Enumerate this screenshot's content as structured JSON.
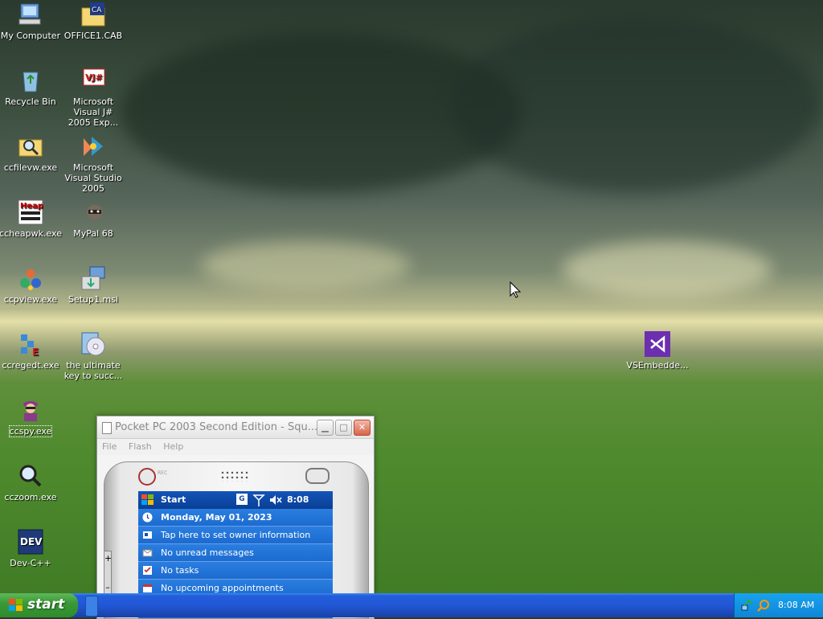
{
  "desktop": {
    "icons": [
      {
        "label": "My Computer",
        "icon": "computer-icon"
      },
      {
        "label": "OFFICE1.CAB",
        "icon": "cab-file-icon"
      },
      {
        "label": "Recycle Bin",
        "icon": "recycle-bin-icon"
      },
      {
        "label": "Microsoft Visual J# 2005 Exp...",
        "icon": "vjsharp-icon"
      },
      {
        "label": "ccfilevw.exe",
        "icon": "magnifier-folder-icon"
      },
      {
        "label": "Microsoft Visual Studio 2005",
        "icon": "visual-studio-icon"
      },
      {
        "label": "ccheapwk.exe",
        "icon": "heap-icon"
      },
      {
        "label": "MyPal 68",
        "icon": "raccoon-icon"
      },
      {
        "label": "ccpview.exe",
        "icon": "process-viewer-icon"
      },
      {
        "label": "Setup1.msi",
        "icon": "installer-icon"
      },
      {
        "label": "ccregedt.exe",
        "icon": "registry-editor-icon"
      },
      {
        "label": "the ultimate key to succ...",
        "icon": "cd-icon"
      },
      {
        "label": "ccspy.exe",
        "icon": "spy-icon"
      },
      {
        "label": "cczoom.exe",
        "icon": "zoom-icon"
      },
      {
        "label": "Dev-C++",
        "icon": "devcpp-icon"
      },
      {
        "label": "VSEmbedde...",
        "icon": "vs-embedded-icon"
      }
    ]
  },
  "emulator": {
    "title": "Pocket PC 2003 Second Edition - Squ...",
    "menu": [
      "File",
      "Flash",
      "Help"
    ],
    "device_rec_label": "REC",
    "nav": {
      "start": "Start",
      "g_label": "G",
      "time": "8:08"
    },
    "today": [
      {
        "text": "Monday, May 01, 2023",
        "icon": "clock-icon",
        "bold": true
      },
      {
        "text": "Tap here to set owner information",
        "icon": "owner-icon"
      },
      {
        "text": "No unread messages",
        "icon": "mail-icon"
      },
      {
        "text": "No tasks",
        "icon": "tasks-icon"
      },
      {
        "text": "No upcoming appointments",
        "icon": "calendar-icon"
      }
    ]
  },
  "taskbar": {
    "start_label": "start",
    "clock": "8:08 AM"
  }
}
